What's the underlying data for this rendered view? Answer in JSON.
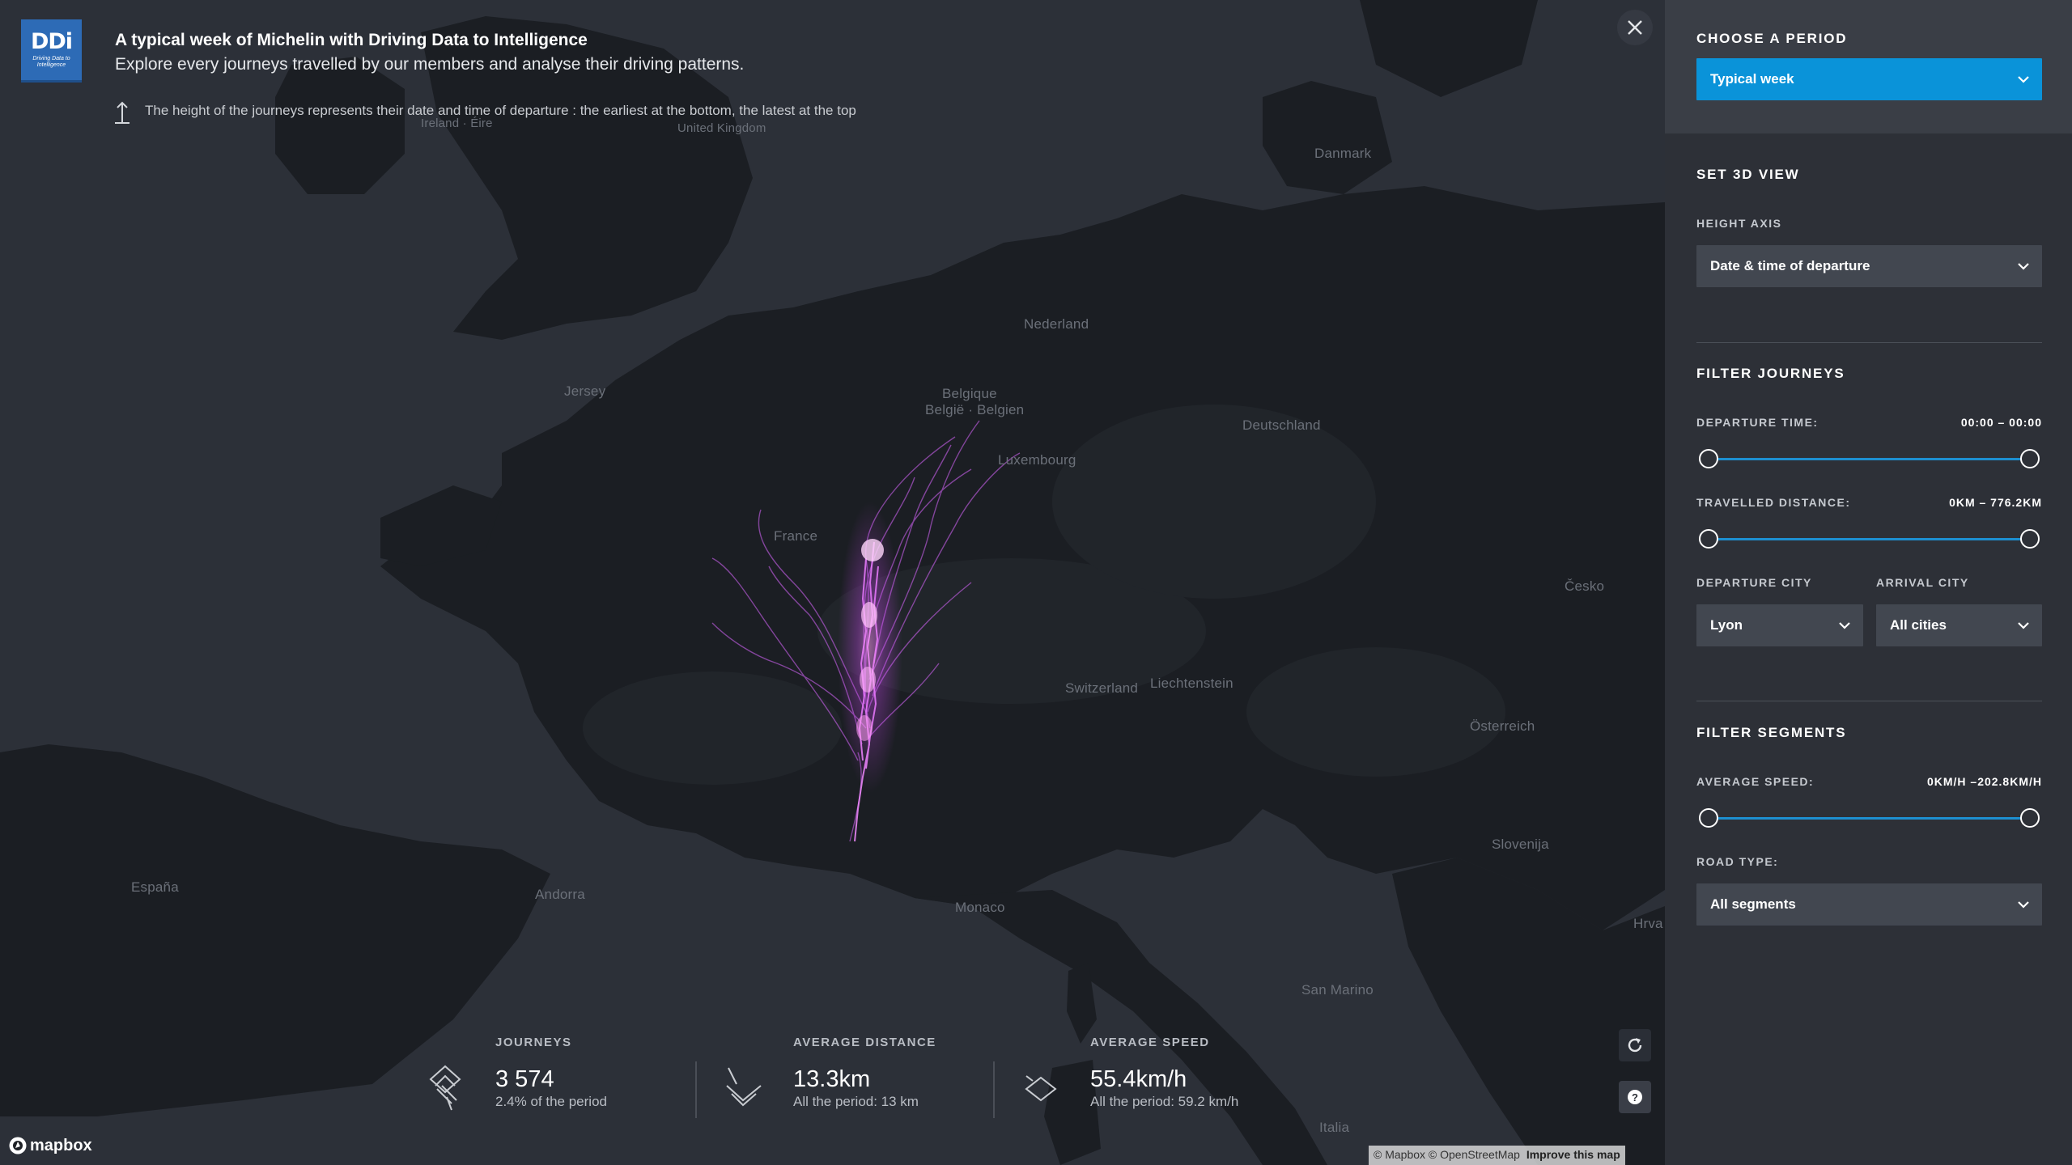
{
  "header": {
    "logo_mark": "DDi",
    "logo_tagline": "Driving Data to Intelligence",
    "title": "A typical week of Michelin with Driving Data to Intelligence",
    "subtitle": "Explore every journeys travelled by our members and analyse their driving patterns.",
    "hint": "The height of the journeys represents their date and time of departure : the earliest at the bottom, the latest at the top",
    "hint_icon": "arrow-up-icon",
    "close_icon": "close-icon"
  },
  "map": {
    "places": [
      "Ireland · Éire",
      "United Kingdom",
      "Danmark",
      "Nederland",
      "Jersey",
      "Belgique",
      "België · Belgien",
      "Luxembourg",
      "Deutschland",
      "France",
      "Česko",
      "Switzerland",
      "Liechtenstein",
      "Österreich",
      "Slovenija",
      "España",
      "Andorra",
      "Monaco",
      "San Marino",
      "Hrva",
      "Italia"
    ],
    "journey_color": "#d64bff",
    "reset_icon": "refresh-icon",
    "help_icon": "question-icon",
    "mapbox_label": "mapbox",
    "attribution": "© Mapbox © OpenStreetMap",
    "improve_link": "Improve this map"
  },
  "stats": [
    {
      "label": "JOURNEYS",
      "value": "3 574",
      "sub": "2.4% of the period",
      "icon": "journeys-icon"
    },
    {
      "label": "AVERAGE DISTANCE",
      "value": "13.3km",
      "sub": "All the period: 13 km",
      "icon": "distance-icon"
    },
    {
      "label": "AVERAGE SPEED",
      "value": "55.4km/h",
      "sub": "All the period: 59.2 km/h",
      "icon": "speed-icon"
    }
  ],
  "panel": {
    "period_heading": "CHOOSE A PERIOD",
    "period_value": "Typical week",
    "view_heading": "SET 3D VIEW",
    "height_axis_label": "HEIGHT AXIS",
    "height_axis_value": "Date & time of departure",
    "filter_journeys_heading": "FILTER JOURNEYS",
    "departure_time_label": "DEPARTURE TIME:",
    "departure_time_range": "00:00 – 00:00",
    "distance_label": "TRAVELLED DISTANCE:",
    "distance_range": "0KM – 776.2KM",
    "departure_city_label": "DEPARTURE CITY",
    "departure_city_value": "Lyon",
    "arrival_city_label": "ARRIVAL CITY",
    "arrival_city_value": "All cities",
    "filter_segments_heading": "FILTER SEGMENTS",
    "speed_label": "AVERAGE SPEED:",
    "speed_range": "0KM/H –202.8KM/H",
    "road_type_label": "ROAD TYPE:",
    "road_type_value": "All segments",
    "accent_color": "#0a93d9"
  }
}
